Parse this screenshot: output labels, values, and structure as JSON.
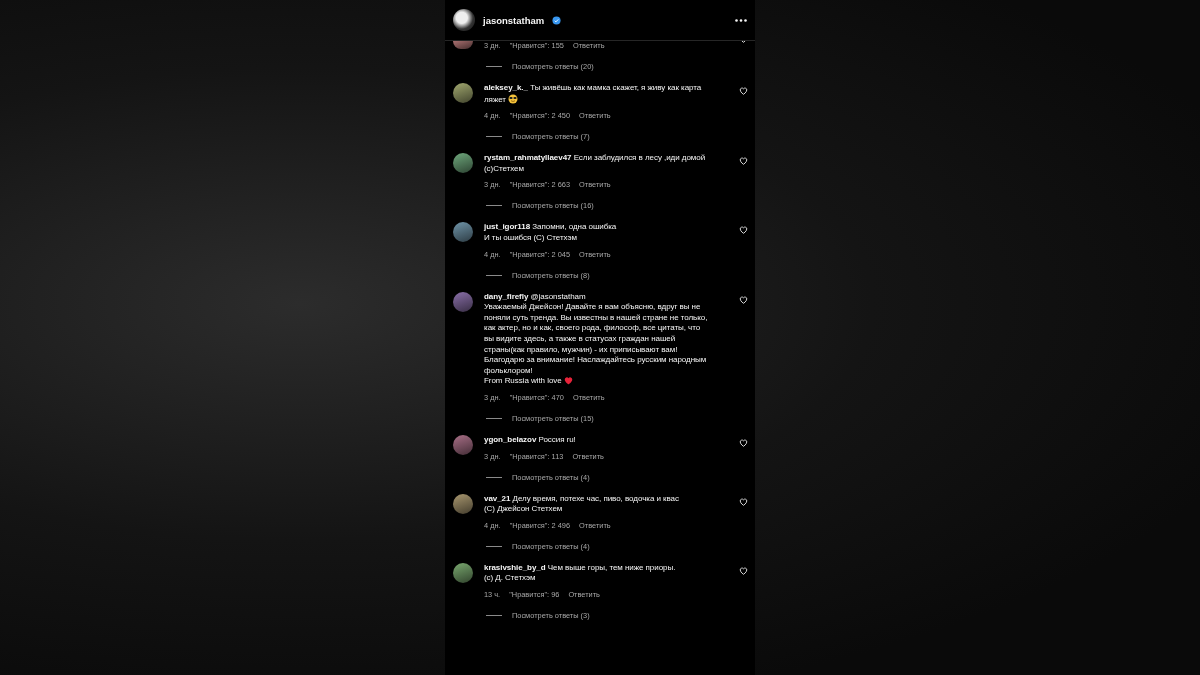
{
  "header": {
    "username": "jasonstatham",
    "verified": true
  },
  "comments": [
    {
      "time": "3 дн.",
      "likes": "\"Нравится\": 155",
      "reply": "Ответить",
      "view_replies": "Посмотреть ответы (20)",
      "partial": true
    },
    {
      "username": "aleksey_k._",
      "text": "Ты живёшь как мамка скажет, я живу как карта\nляжет",
      "sunglasses_emoji": true,
      "time": "4 дн.",
      "likes": "\"Нравится\": 2 450",
      "reply": "Ответить",
      "view_replies": "Посмотреть ответы (7)"
    },
    {
      "username": "rystam_rahmatyllaev47",
      "text": "Если заблудился в лесу ,иди домой\n(c)Стетхем",
      "time": "3 дн.",
      "likes": "\"Нравится\": 2 663",
      "reply": "Ответить",
      "view_replies": "Посмотреть ответы (16)"
    },
    {
      "username": "just_igor118",
      "text": "Запомни, одна ошибка\nИ ты ошибся (С) Стетхэм",
      "time": "4 дн.",
      "likes": "\"Нравится\": 2 045",
      "reply": "Ответить",
      "view_replies": "Посмотреть ответы (8)"
    },
    {
      "username": "dany_firefly",
      "text": "@jasonstatham\nУважаемый Джейсон! Давайте я вам объясню, вдруг вы не\nпоняли суть тренда. Вы известны в нашей стране не только,\nкак актер, но и как, своего рода, философ, все цитаты, что\nвы видите здесь, а также в статусах граждан нашей\nстраны(как правило, мужчин) - их приписывают вам!\nБлагодарю за внимание! Наслаждайтесь русским народным\nфольклором!\nFrom Russia with love",
      "heart_emoji": true,
      "time": "3 дн.",
      "likes": "\"Нравится\": 470",
      "reply": "Ответить",
      "view_replies": "Посмотреть ответы (15)"
    },
    {
      "username": "ygon_belazov",
      "text": "Россия ru!",
      "time": "3 дн.",
      "likes": "\"Нравится\": 113",
      "reply": "Ответить",
      "view_replies": "Посмотреть ответы (4)"
    },
    {
      "username": "vav_21",
      "text": "Делу время, потехе час, пиво, водочка и квас\n(С) Джейсон Стетхем",
      "time": "4 дн.",
      "likes": "\"Нравится\": 2 496",
      "reply": "Ответить",
      "view_replies": "Посмотреть ответы (4)"
    },
    {
      "username": "krasivshie_by_d",
      "text": "Чем выше горы, тем ниже приоры.\n(с) Д. Стетхэм",
      "time": "13 ч.",
      "likes": "\"Нравится\": 96",
      "reply": "Ответить",
      "view_replies": "Посмотреть ответы (3)"
    }
  ]
}
